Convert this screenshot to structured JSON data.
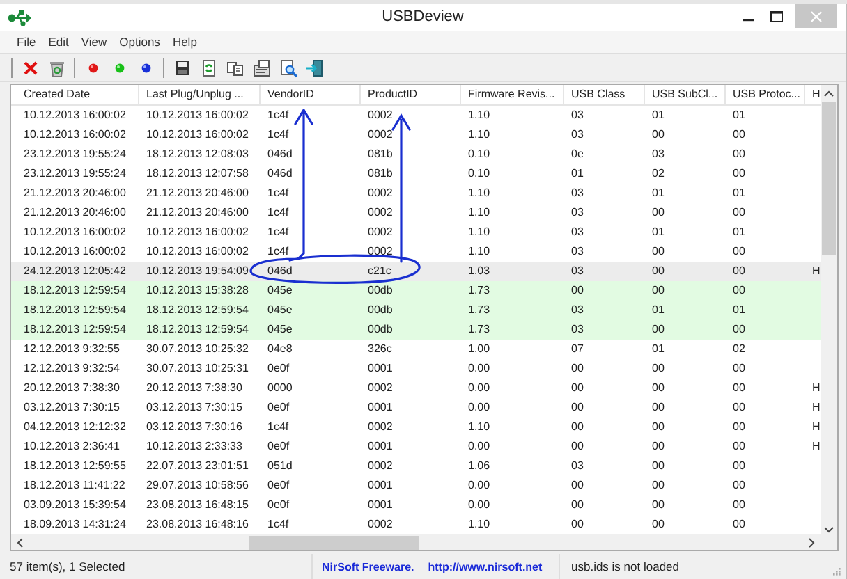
{
  "window": {
    "title": "USBDeview"
  },
  "menu": [
    {
      "label": "File"
    },
    {
      "label": "Edit"
    },
    {
      "label": "View"
    },
    {
      "label": "Options"
    },
    {
      "label": "Help"
    }
  ],
  "table": {
    "columns": [
      "Created Date",
      "Last Plug/Unplug ...",
      "VendorID",
      "ProductID",
      "Firmware Revis...",
      "USB Class",
      "USB SubCl...",
      "USB Protoc...",
      "H"
    ],
    "rows": [
      {
        "cells": [
          "10.12.2013 16:00:02",
          "10.12.2013 16:00:02",
          "1c4f",
          "0002",
          "1.10",
          "03",
          "01",
          "01"
        ],
        "selected": false,
        "highlighted": false
      },
      {
        "cells": [
          "10.12.2013 16:00:02",
          "10.12.2013 16:00:02",
          "1c4f",
          "0002",
          "1.10",
          "03",
          "00",
          "00"
        ],
        "selected": false,
        "highlighted": false
      },
      {
        "cells": [
          "23.12.2013 19:55:24",
          "18.12.2013 12:08:03",
          "046d",
          "081b",
          "0.10",
          "0e",
          "03",
          "00"
        ],
        "selected": false,
        "highlighted": false
      },
      {
        "cells": [
          "23.12.2013 19:55:24",
          "18.12.2013 12:07:58",
          "046d",
          "081b",
          "0.10",
          "01",
          "02",
          "00"
        ],
        "selected": false,
        "highlighted": false
      },
      {
        "cells": [
          "21.12.2013 20:46:00",
          "21.12.2013 20:46:00",
          "1c4f",
          "0002",
          "1.10",
          "03",
          "01",
          "01"
        ],
        "selected": false,
        "highlighted": false
      },
      {
        "cells": [
          "21.12.2013 20:46:00",
          "21.12.2013 20:46:00",
          "1c4f",
          "0002",
          "1.10",
          "03",
          "00",
          "00"
        ],
        "selected": false,
        "highlighted": false
      },
      {
        "cells": [
          "10.12.2013 16:00:02",
          "10.12.2013 16:00:02",
          "1c4f",
          "0002",
          "1.10",
          "03",
          "01",
          "01"
        ],
        "selected": false,
        "highlighted": false
      },
      {
        "cells": [
          "10.12.2013 16:00:02",
          "10.12.2013 16:00:02",
          "1c4f",
          "0002",
          "1.10",
          "03",
          "00",
          "00"
        ],
        "selected": false,
        "highlighted": false
      },
      {
        "cells": [
          "24.12.2013 12:05:42",
          "10.12.2013 19:54:09",
          "046d",
          "c21c",
          "1.03",
          "03",
          "00",
          "00",
          "H"
        ],
        "selected": true,
        "highlighted": false
      },
      {
        "cells": [
          "18.12.2013 12:59:54",
          "10.12.2013 15:38:28",
          "045e",
          "00db",
          "1.73",
          "00",
          "00",
          "00"
        ],
        "selected": false,
        "highlighted": true
      },
      {
        "cells": [
          "18.12.2013 12:59:54",
          "18.12.2013 12:59:54",
          "045e",
          "00db",
          "1.73",
          "03",
          "01",
          "01"
        ],
        "selected": false,
        "highlighted": true
      },
      {
        "cells": [
          "18.12.2013 12:59:54",
          "18.12.2013 12:59:54",
          "045e",
          "00db",
          "1.73",
          "03",
          "00",
          "00"
        ],
        "selected": false,
        "highlighted": true
      },
      {
        "cells": [
          "12.12.2013 9:32:55",
          "30.07.2013 10:25:32",
          "04e8",
          "326c",
          "1.00",
          "07",
          "01",
          "02"
        ],
        "selected": false,
        "highlighted": false
      },
      {
        "cells": [
          "12.12.2013 9:32:54",
          "30.07.2013 10:25:31",
          "0e0f",
          "0001",
          "0.00",
          "00",
          "00",
          "00"
        ],
        "selected": false,
        "highlighted": false
      },
      {
        "cells": [
          "20.12.2013 7:38:30",
          "20.12.2013 7:38:30",
          "0000",
          "0002",
          "0.00",
          "00",
          "00",
          "00",
          "H"
        ],
        "selected": false,
        "highlighted": false
      },
      {
        "cells": [
          "03.12.2013 7:30:15",
          "03.12.2013 7:30:15",
          "0e0f",
          "0001",
          "0.00",
          "00",
          "00",
          "00",
          "H"
        ],
        "selected": false,
        "highlighted": false
      },
      {
        "cells": [
          "04.12.2013 12:12:32",
          "03.12.2013 7:30:16",
          "1c4f",
          "0002",
          "1.10",
          "00",
          "00",
          "00",
          "H"
        ],
        "selected": false,
        "highlighted": false
      },
      {
        "cells": [
          "10.12.2013 2:36:41",
          "10.12.2013 2:33:33",
          "0e0f",
          "0001",
          "0.00",
          "00",
          "00",
          "00",
          "H"
        ],
        "selected": false,
        "highlighted": false
      },
      {
        "cells": [
          "18.12.2013 12:59:55",
          "22.07.2013 23:01:51",
          "051d",
          "0002",
          "1.06",
          "03",
          "00",
          "00"
        ],
        "selected": false,
        "highlighted": false
      },
      {
        "cells": [
          "18.12.2013 11:41:22",
          "29.07.2013 10:58:56",
          "0e0f",
          "0001",
          "0.00",
          "00",
          "00",
          "00"
        ],
        "selected": false,
        "highlighted": false
      },
      {
        "cells": [
          "03.09.2013 15:39:54",
          "23.08.2013 16:48:15",
          "0e0f",
          "0001",
          "0.00",
          "00",
          "00",
          "00"
        ],
        "selected": false,
        "highlighted": false
      },
      {
        "cells": [
          "18.09.2013 14:31:24",
          "23.08.2013 16:48:16",
          "1c4f",
          "0002",
          "1.10",
          "00",
          "00",
          "00"
        ],
        "selected": false,
        "highlighted": false
      }
    ]
  },
  "status_bar": {
    "count": "57 item(s), 1 Selected",
    "credit": "NirSoft Freeware.",
    "link": "http://www.nirsoft.net",
    "message": "usb.ids is not loaded"
  }
}
